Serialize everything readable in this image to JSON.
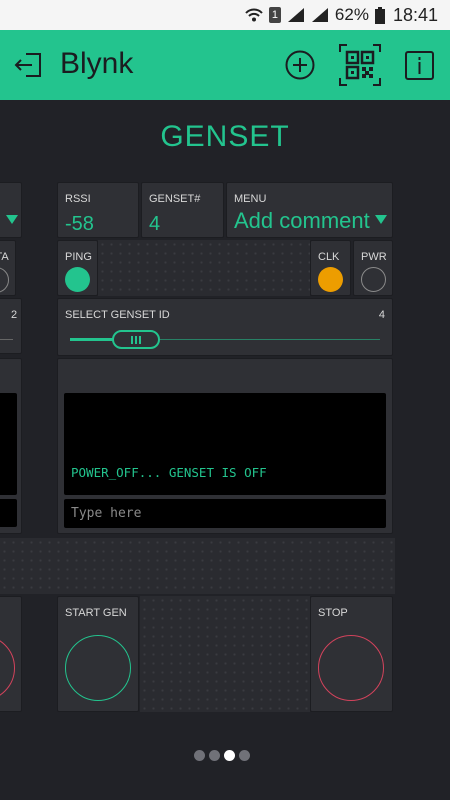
{
  "status_bar": {
    "sim_badge": "1",
    "battery": "62%",
    "time": "18:41"
  },
  "app_bar": {
    "title": "Blynk"
  },
  "dashboard": {
    "title": "GENSET"
  },
  "colors": {
    "accent": "#23c48e",
    "clk_led": "#ed9d00",
    "stop": "#d3435c",
    "bg": "#212227",
    "widget": "#2f3035"
  },
  "widgets": {
    "rssi": {
      "label": "RSSI",
      "value": "-58"
    },
    "genset_num": {
      "label": "GENSET#",
      "value": "4"
    },
    "menu": {
      "label": "MENU",
      "value": "Add comment"
    },
    "ping": {
      "label": "PING"
    },
    "clk": {
      "label": "CLK"
    },
    "pwr": {
      "label": "PWR"
    },
    "slider": {
      "label": "SELECT GENSET ID",
      "value": "4",
      "level": 0.3
    },
    "terminal": {
      "output": "POWER_OFF... GENSET IS OFF",
      "placeholder": "Type here"
    },
    "start": {
      "label": "START GEN"
    },
    "stop": {
      "label": "STOP"
    }
  },
  "left_partial": {
    "ata_label": "ATA",
    "slider_value": "2"
  },
  "pagination": {
    "pages": 4,
    "active": 3
  }
}
